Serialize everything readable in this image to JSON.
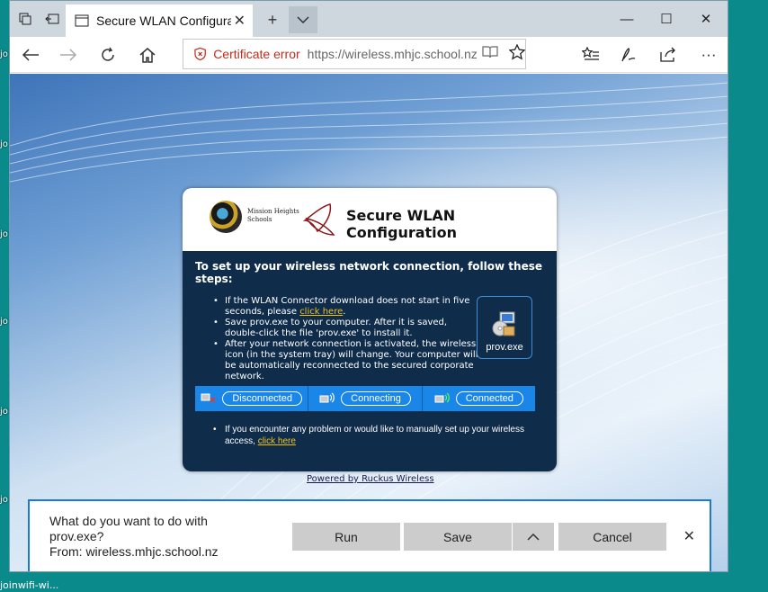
{
  "desktop": {
    "labels": [
      "jo",
      "jo",
      "jo",
      "jo",
      "jo",
      "jo",
      "jo"
    ],
    "bottom_label": "joinwifi-wi..."
  },
  "browser": {
    "tab_title": "Secure WLAN Configura",
    "tab_close": "✕",
    "new_tab": "+",
    "tab_menu": "⌄",
    "cert_error": "Certificate error",
    "url": "https://wireless.mhjc.school.nz/user,",
    "window_controls": [
      "—",
      "☐",
      "✕"
    ],
    "more": "···"
  },
  "dialog": {
    "logo_text_line1": "Mission Heights",
    "logo_text_line2": "Schools",
    "title": "Secure WLAN Configuration",
    "heading": "To set up your wireless network connection, follow these steps:",
    "step1_text": "If the WLAN Connector download does not start in five seconds, please ",
    "step1_link": "click here",
    "step1_end": ".",
    "step2": "Save prov.exe to your computer. After it is saved, double-click the file 'prov.exe' to install it.",
    "step3": "After your network connection is activated, the wireless icon (in the system tray) will change. Your computer will be automatically reconnected to the secured corporate network.",
    "prov_label": "prov.exe",
    "status": [
      "Disconnected",
      "Connecting",
      "Connected"
    ],
    "trouble_text": "If you encounter any problem or would like to manually set up your wireless access, ",
    "trouble_link": "click here"
  },
  "powered_by": "Powered by Ruckus Wireless",
  "download_bar": {
    "line1": "What do you want to do with",
    "line2": "prov.exe?",
    "line3": "From: wireless.mhjc.school.nz",
    "run": "Run",
    "save": "Save",
    "cancel": "Cancel",
    "close": "✕"
  }
}
